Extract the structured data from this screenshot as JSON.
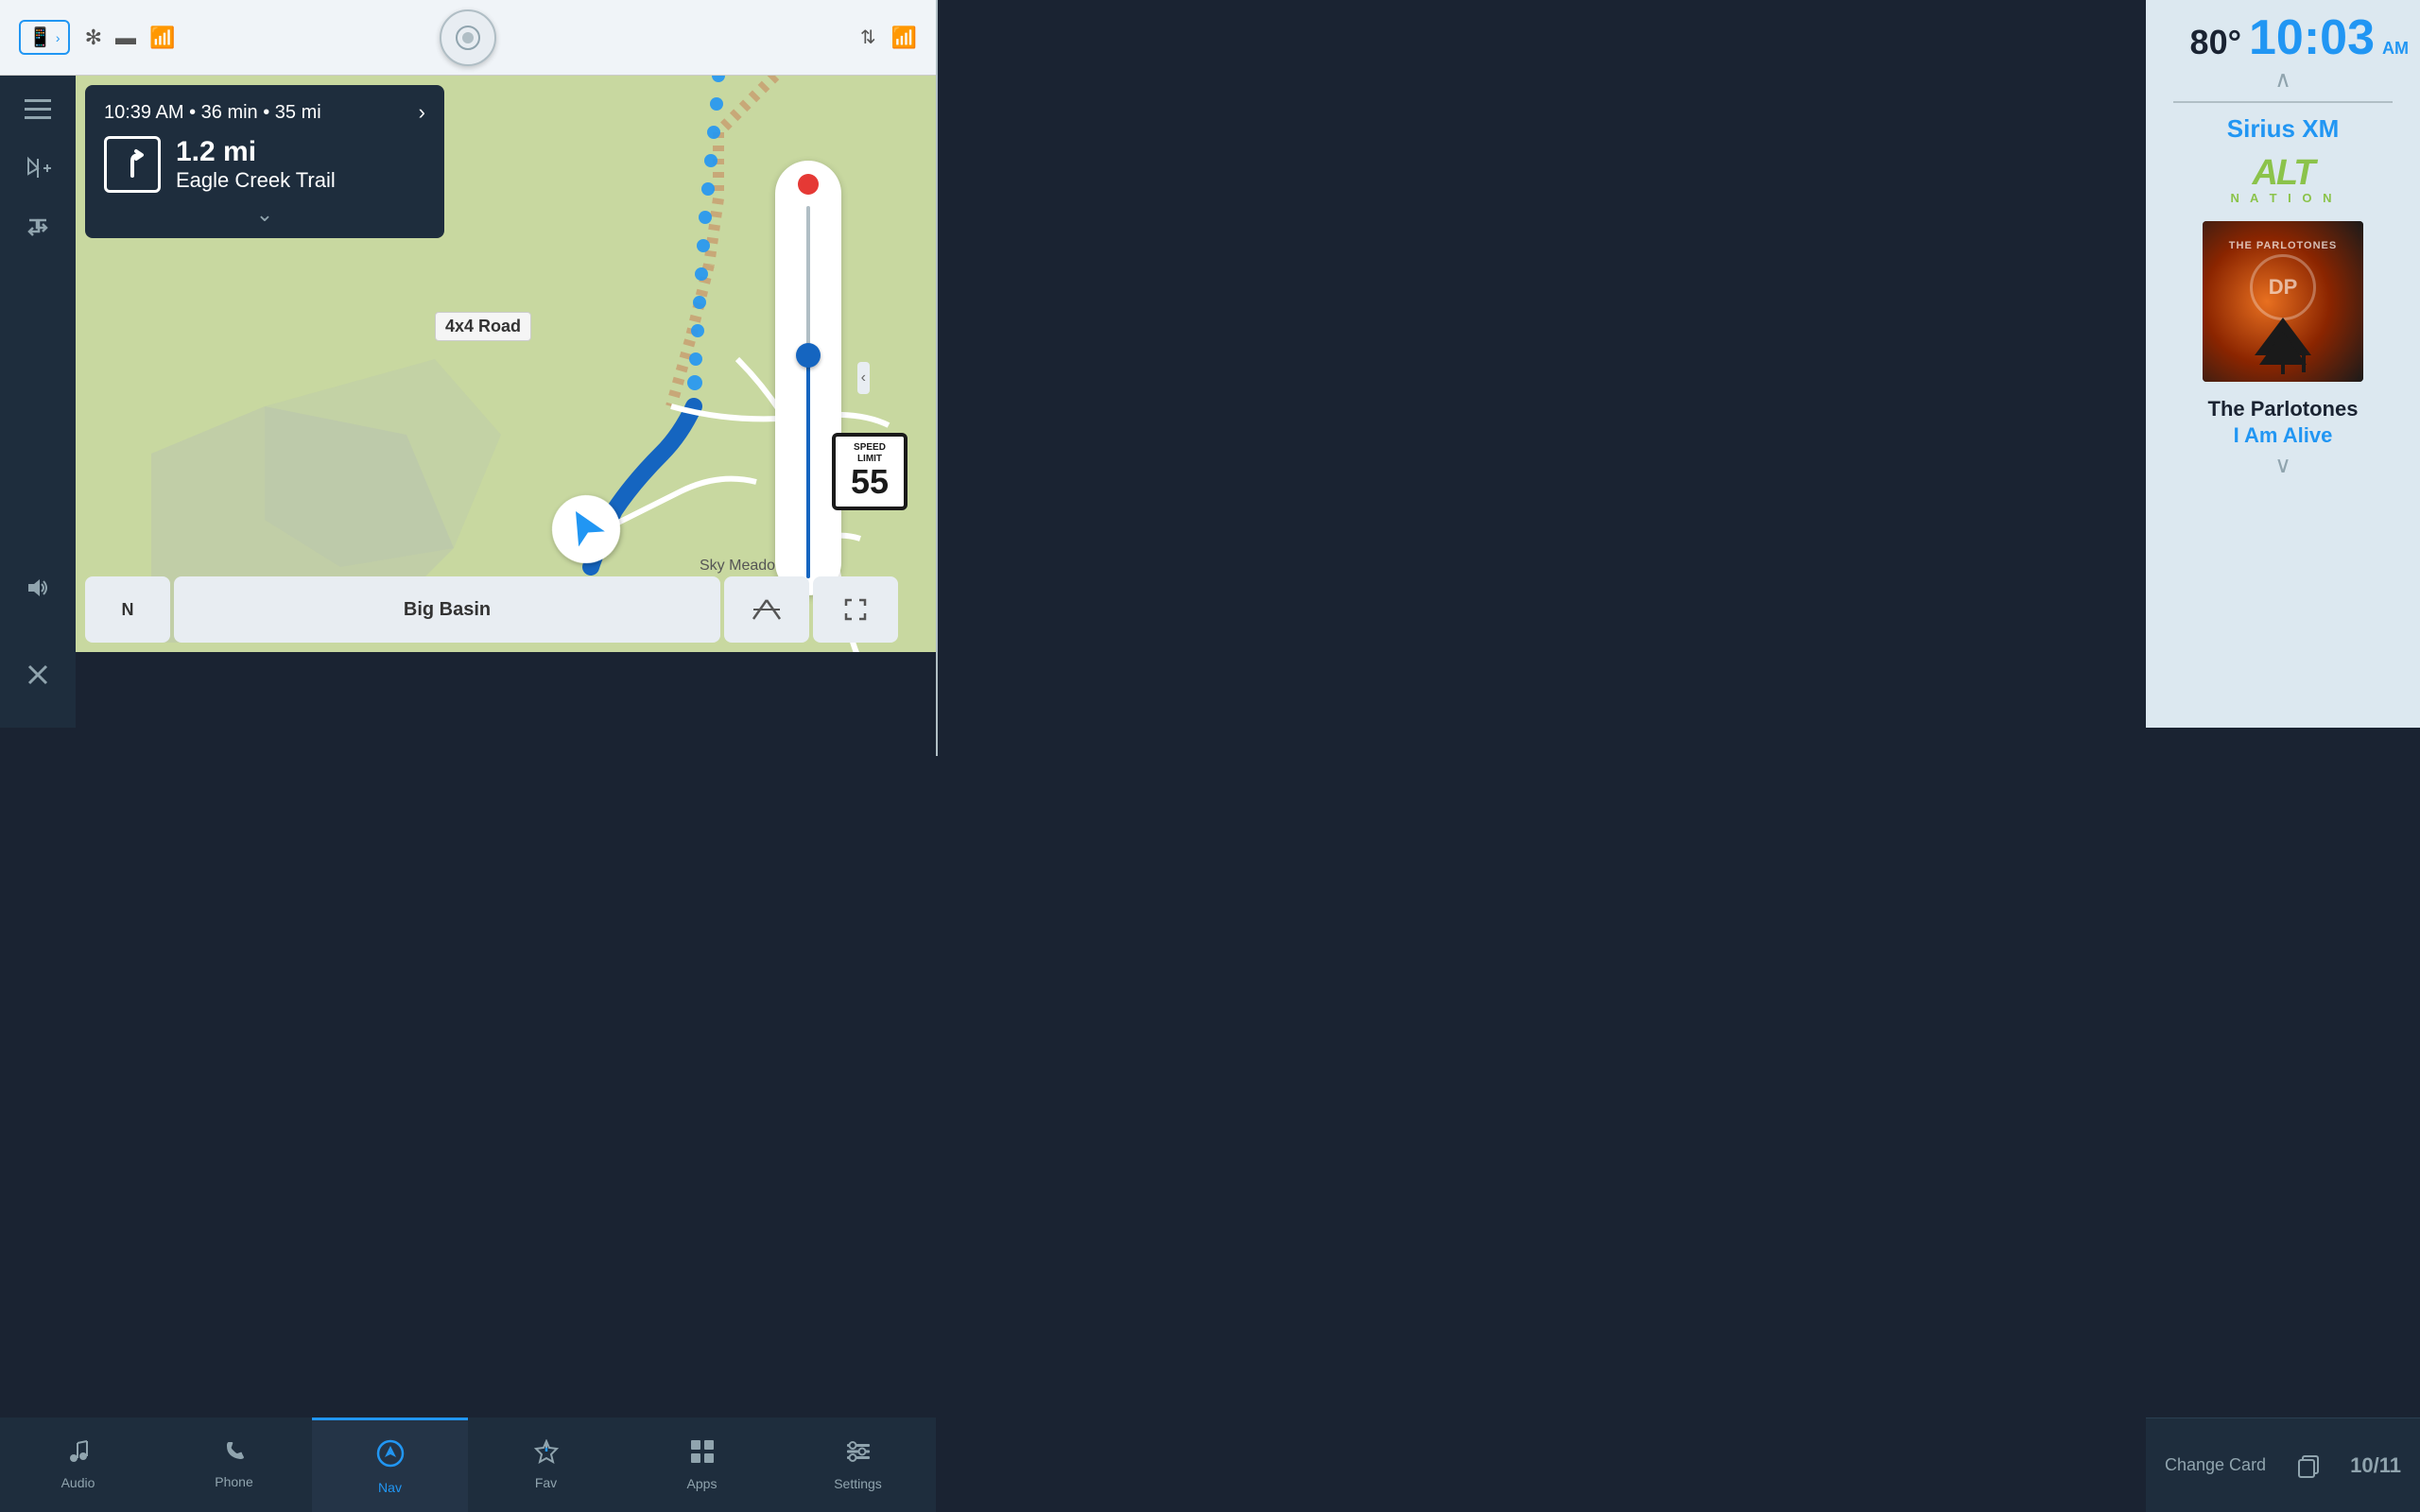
{
  "statusBar": {
    "temperature": "80°",
    "time": "10:03",
    "ampm": "AM",
    "voiceBtn": "○"
  },
  "rightPanel": {
    "siriusXM": "Sirius XM",
    "altNation": {
      "alt": "ALT",
      "nation": "N A T I O N"
    },
    "artist": "The Parlotones",
    "song": "I Am Alive",
    "chevron": "⌄"
  },
  "navCard": {
    "eta": "10:39 AM",
    "duration": "36 min",
    "distance": "35 mi",
    "turnDistance": "1.2 mi",
    "street": "Eagle Creek Trail",
    "expandIcon": "⌄"
  },
  "mapLabels": {
    "roadLabel": "4x4 Road",
    "areaLabel": "Sky Meado",
    "regionLabel": "Big Basin"
  },
  "speedLimit": {
    "top": "SPEED\nLIMIT",
    "number": "55"
  },
  "mapControls": {
    "north": "N",
    "destination": "Big Basin",
    "viewMode": "/i\\",
    "expand": "⤢"
  },
  "bottomNav": {
    "tabs": [
      {
        "id": "audio",
        "label": "Audio",
        "icon": "♪"
      },
      {
        "id": "phone",
        "label": "Phone",
        "icon": "✆"
      },
      {
        "id": "nav",
        "label": "Nav",
        "icon": "⊕",
        "active": true
      },
      {
        "id": "fav",
        "label": "Fav",
        "icon": "☆"
      },
      {
        "id": "apps",
        "label": "Apps",
        "icon": "⊞"
      },
      {
        "id": "settings",
        "label": "Settings",
        "icon": "≡"
      }
    ]
  },
  "bottomRight": {
    "changeCard": "Change Card",
    "cardNum": "10/11"
  },
  "sidebar": {
    "icons": [
      {
        "id": "menu",
        "icon": "≡"
      },
      {
        "id": "add-route",
        "icon": "⚑+"
      },
      {
        "id": "route-options",
        "icon": "⇅"
      },
      {
        "id": "volume",
        "icon": "◁)"
      },
      {
        "id": "close",
        "icon": "✕"
      }
    ]
  }
}
